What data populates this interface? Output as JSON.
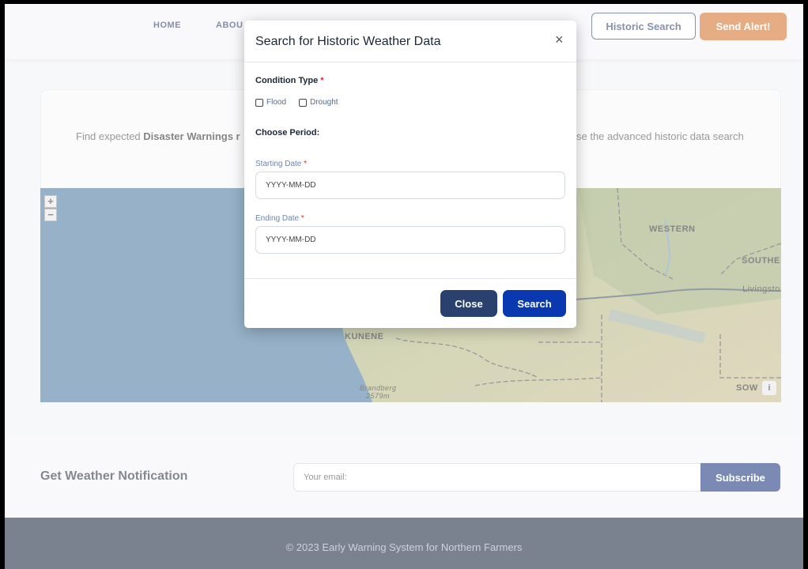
{
  "nav": {
    "items": [
      "HOME",
      "ABOU"
    ],
    "historic_search": "Historic Search",
    "send_alert": "Send Alert!"
  },
  "info": {
    "left_plain": "Find expected ",
    "left_bold": "Disaster Warnings r",
    "right_text": "se the advanced historic data search"
  },
  "map": {
    "zoom_in": "+",
    "zoom_out": "−",
    "labels": {
      "western": "WESTERN",
      "southern": "SOUTHE",
      "livingstone": "Livingsto",
      "kunene": "KUNENE",
      "brandberg": "Brandberg",
      "brandberg_height": "2579m",
      "sow": "SOW"
    },
    "info_button": "i"
  },
  "notification": {
    "title": "Get Weather Notification",
    "email_placeholder": "Your email:",
    "subscribe": "Subscribe"
  },
  "footer": {
    "text": "© 2023 Early Warning System for Northern Farmers"
  },
  "modal": {
    "title": "Search for Historic Weather Data",
    "close_symbol": "×",
    "condition_label": "Condition Type",
    "required_mark": "*",
    "conditions": [
      "Flood",
      "Drought"
    ],
    "period_label": "Choose Period:",
    "start_label": "Starting Date",
    "start_placeholder": "YYYY-MM-DD",
    "end_label": "Ending Date",
    "end_placeholder": "YYYY-MM-DD",
    "close_button": "Close",
    "search_button": "Search"
  },
  "colors": {
    "accent_orange": "#d2691e",
    "primary_blue": "#0a38b0",
    "navy": "#0d1a33"
  }
}
